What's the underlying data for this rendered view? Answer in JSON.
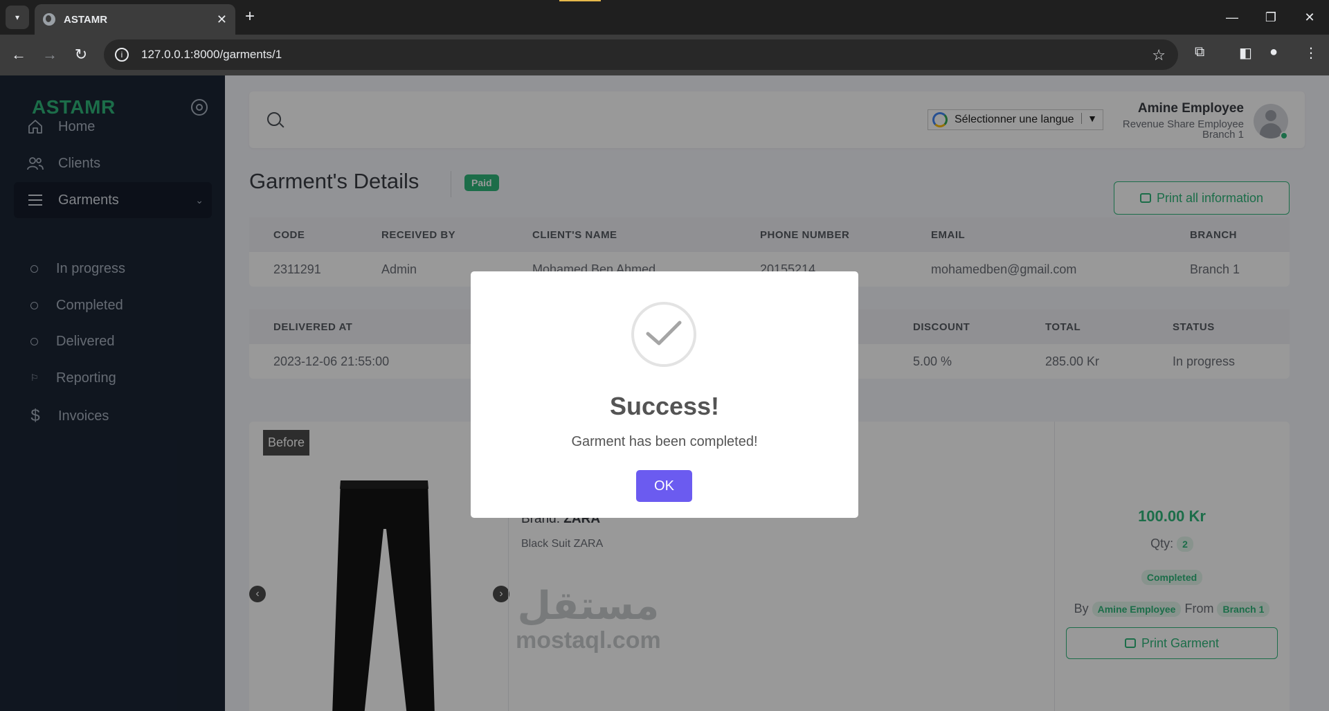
{
  "browser": {
    "tab_title": "ASTAMR",
    "url": "127.0.0.1:8000/garments/1"
  },
  "sidebar": {
    "logo": "ASTAMR",
    "items": [
      {
        "label": "Home"
      },
      {
        "label": "Clients"
      },
      {
        "label": "Garments"
      },
      {
        "label": "In progress"
      },
      {
        "label": "Completed"
      },
      {
        "label": "Delivered"
      },
      {
        "label": "Reporting"
      },
      {
        "label": "Invoices"
      }
    ]
  },
  "topbar": {
    "language_select": "Sélectionner une langue",
    "user_name": "Amine Employee",
    "user_role": "Revenue Share Employee",
    "user_branch": "Branch 1"
  },
  "page": {
    "title": "Garment's Details",
    "status_badge": "Paid",
    "print_all_label": "Print all information"
  },
  "table1": {
    "headers": [
      "CODE",
      "RECEIVED BY",
      "CLIENT'S NAME",
      "PHONE NUMBER",
      "EMAIL",
      "BRANCH"
    ],
    "row": [
      "2311291",
      "Admin",
      "Mohamed Ben Ahmed",
      "20155214",
      "mohamedben@gmail.com",
      "Branch 1"
    ]
  },
  "table2": {
    "headers": [
      "DELIVERED AT",
      "DISCOUNT",
      "TOTAL",
      "STATUS"
    ],
    "row": [
      "2023-12-06 21:55:00",
      "5.00 %",
      "285.00 Kr",
      "In progress"
    ]
  },
  "garment": {
    "before_label": "Before",
    "brand_label": "Brand:",
    "brand_value": "ZARA",
    "description": "Black Suit ZARA",
    "price": "100.00 Kr",
    "qty_label": "Qty:",
    "qty_value": "2",
    "status": "Completed",
    "by_label": "By",
    "by_value": "Amine Employee",
    "from_label": "From",
    "from_value": "Branch 1",
    "print_label": "Print Garment"
  },
  "watermark": {
    "arabic": "مستقل",
    "latin": "mostaql.com"
  },
  "modal": {
    "title": "Success!",
    "message": "Garment has been completed!",
    "ok_label": "OK"
  },
  "colors": {
    "accent_green": "#2fb67a",
    "sidebar_bg": "#1b2535",
    "ok_button": "#6b5bf0"
  }
}
